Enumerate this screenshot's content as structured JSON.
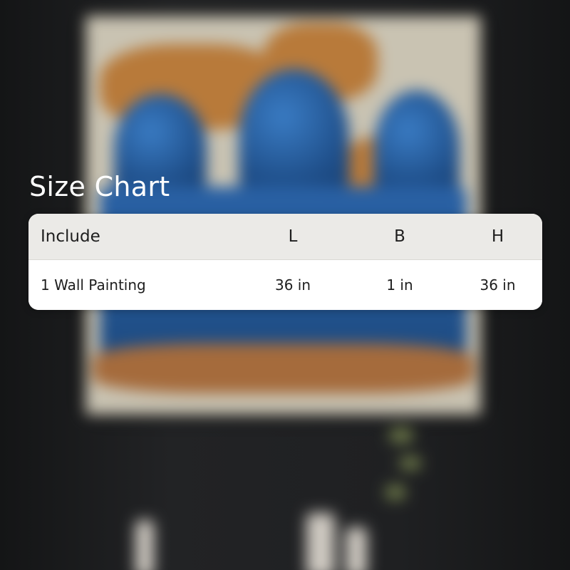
{
  "size_chart": {
    "title": "Size Chart",
    "headers": {
      "include": "Include",
      "l": "L",
      "b": "B",
      "h": "H"
    },
    "rows": [
      {
        "include": "1 Wall Painting",
        "l": "36 in",
        "b": "1 in",
        "h": "36 in"
      }
    ]
  },
  "colors": {
    "title_text": "#ffffff",
    "table_header_bg": "#ebeae7",
    "table_body_bg": "#ffffff",
    "table_text": "#1e1e1e"
  }
}
